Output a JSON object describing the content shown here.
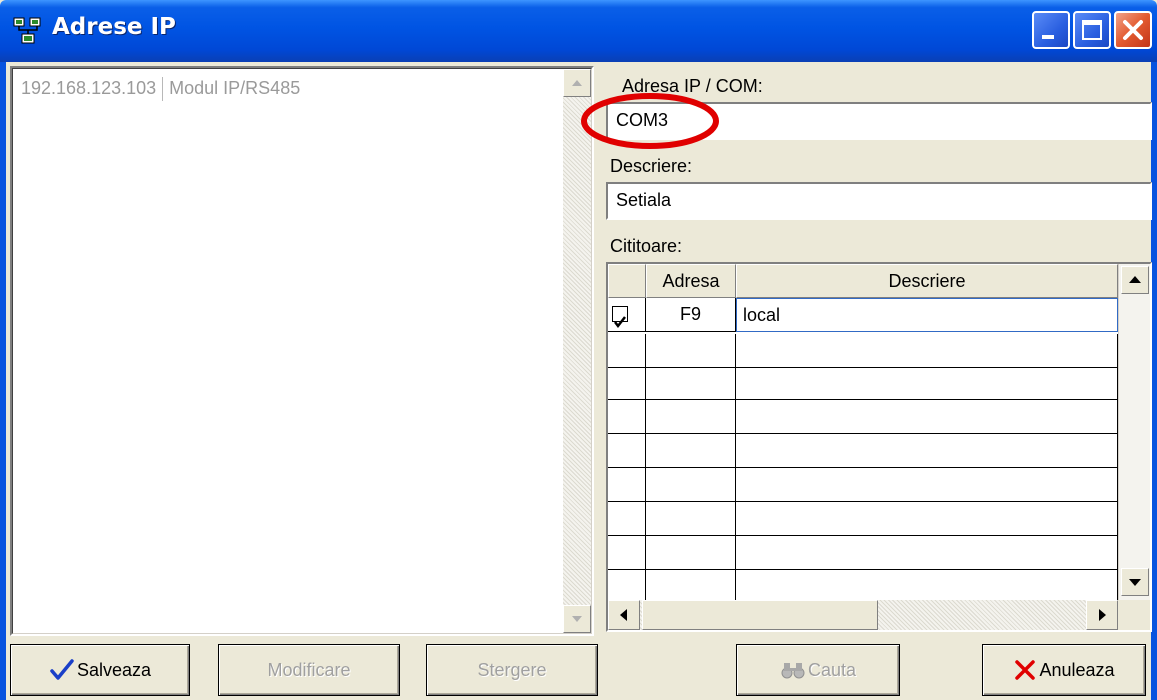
{
  "window": {
    "title": "Adrese IP",
    "buttons": [
      "minimize",
      "maximize",
      "close"
    ]
  },
  "left_list": {
    "rows": [
      {
        "address": "192.168.123.103",
        "description": "Modul IP/RS485"
      }
    ]
  },
  "form": {
    "address_label": "Adresa IP / COM:",
    "address_value": "COM3",
    "description_label": "Descriere:",
    "description_value": "Setiala",
    "readers_label": "Cititoare:"
  },
  "readers_grid": {
    "columns": [
      "",
      "Adresa",
      "Descriere"
    ],
    "rows": [
      {
        "checked": true,
        "address": "F9",
        "description": "local"
      }
    ],
    "empty_rows": 8
  },
  "buttons": {
    "save": "Salveaza",
    "modify": "Modificare",
    "delete": "Stergere",
    "search": "Cauta",
    "cancel": "Anuleaza"
  },
  "colors": {
    "titlebar": "#0054e3",
    "annotation_red": "#e00000",
    "disabled_text": "#a0a0a0"
  },
  "icons": [
    "network-icon",
    "checkmark-icon",
    "binoculars-icon",
    "x-icon"
  ]
}
